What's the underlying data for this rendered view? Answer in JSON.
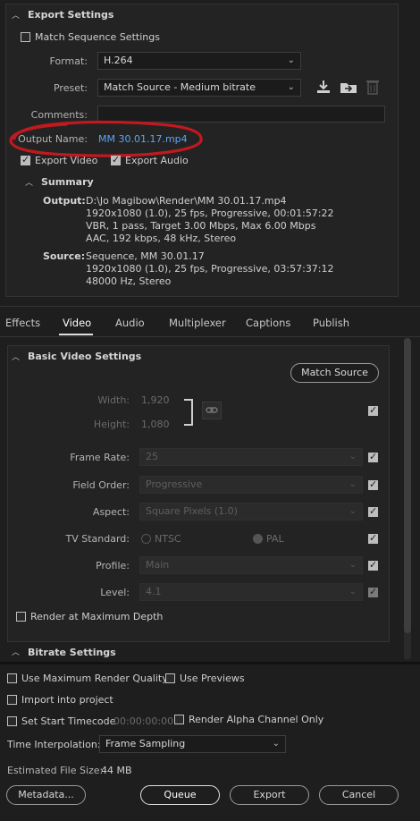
{
  "export": {
    "title": "Export Settings",
    "match_sequence_label": "Match Sequence Settings",
    "format_label": "Format:",
    "format_value": "H.264",
    "preset_label": "Preset:",
    "preset_value": "Match Source - Medium bitrate",
    "comments_label": "Comments:",
    "comments_value": "",
    "output_name_label": "Output Name:",
    "output_name_value": "MM 30.01.17.mp4",
    "export_video_label": "Export Video",
    "export_audio_label": "Export Audio"
  },
  "summary": {
    "title": "Summary",
    "output_label": "Output:",
    "output_lines": [
      "D:\\Jo Magibow\\Render\\MM 30.01.17.mp4",
      "1920x1080 (1.0), 25 fps, Progressive, 00:01:57:22",
      "VBR, 1 pass, Target 3.00 Mbps, Max 6.00 Mbps",
      "AAC, 192 kbps, 48 kHz, Stereo"
    ],
    "source_label": "Source:",
    "source_lines": [
      "Sequence, MM 30.01.17",
      "1920x1080 (1.0), 25 fps, Progressive, 03:57:37:12",
      "48000 Hz, Stereo"
    ]
  },
  "tabs": [
    "Effects",
    "Video",
    "Audio",
    "Multiplexer",
    "Captions",
    "Publish"
  ],
  "video": {
    "basic_title": "Basic Video Settings",
    "match_source_button": "Match Source",
    "width_label": "Width:",
    "width_value": "1,920",
    "height_label": "Height:",
    "height_value": "1,080",
    "frame_rate_label": "Frame Rate:",
    "frame_rate_value": "25",
    "field_order_label": "Field Order:",
    "field_order_value": "Progressive",
    "aspect_label": "Aspect:",
    "aspect_value": "Square Pixels (1.0)",
    "tv_standard_label": "TV Standard:",
    "ntsc_label": "NTSC",
    "pal_label": "PAL",
    "profile_label": "Profile:",
    "profile_value": "Main",
    "level_label": "Level:",
    "level_value": "4.1",
    "render_max_depth_label": "Render at Maximum Depth",
    "bitrate_title": "Bitrate Settings"
  },
  "footer": {
    "max_render_quality_label": "Use Maximum Render Quality",
    "use_previews_label": "Use Previews",
    "import_project_label": "Import into project",
    "set_start_timecode_label": "Set Start Timecode",
    "timecode_value": "00:00:00:00",
    "render_alpha_label": "Render Alpha Channel Only",
    "time_interp_label": "Time Interpolation:",
    "time_interp_value": "Frame Sampling",
    "est_file_size_label": "Estimated File Size:",
    "est_file_size_value": "44 MB",
    "metadata_button": "Metadata...",
    "queue_button": "Queue",
    "export_button": "Export",
    "cancel_button": "Cancel"
  },
  "colors": {
    "link": "#5aa4f2",
    "highlight_circle": "#c0191f"
  }
}
